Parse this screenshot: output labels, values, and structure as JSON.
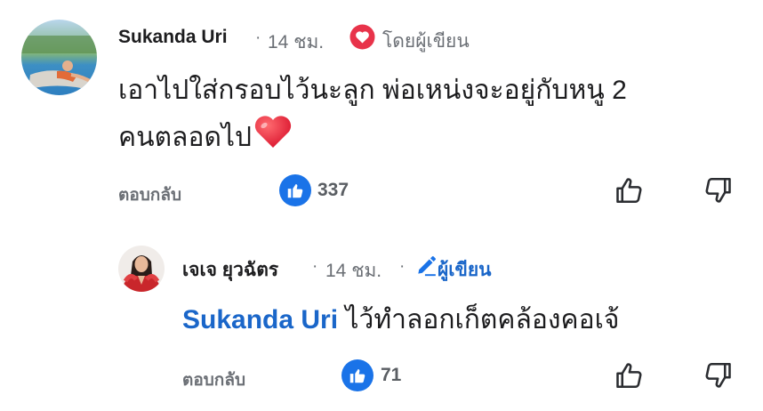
{
  "comment": {
    "author": "Sukanda Uri",
    "time": "14 ชม.",
    "author_badge": "โดยผู้เขียน",
    "text_line1": "เอาไปใส่กรอบไว้นะลูก พ่อเหน่งจะอยู่กับหนู 2",
    "text_line2": "คนตลอดไป",
    "reply_label": "ตอบกลับ",
    "likes": "337"
  },
  "reply": {
    "author": "เจเจ ยุวฉัตร",
    "time": "14 ชม.",
    "author_badge": "ผู้เขียน",
    "mention": "Sukanda Uri",
    "text": " ไว้ทำลอกเก็ตคล้องคอเจ้",
    "reply_label": "ตอบกลับ",
    "likes": "71"
  },
  "separator": "·",
  "colors": {
    "accent": "#1a73e8",
    "mention": "#1a66c9",
    "heart": "#e8334a",
    "meta": "#6b6f75"
  },
  "icons": [
    "heart-badge-icon",
    "like-icon",
    "thumbs-up-icon",
    "thumbs-down-icon",
    "pencil-icon",
    "heart-emoji-icon"
  ]
}
